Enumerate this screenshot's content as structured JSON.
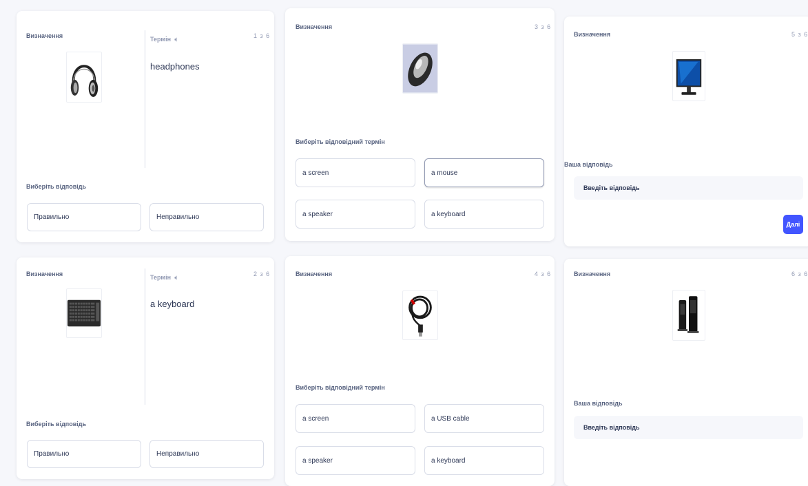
{
  "cards": [
    {
      "definition_label": "Визначення",
      "term_label": "Термін",
      "speaker_icon": "speaker-icon",
      "counter": "1 з 6",
      "image": "headphones-image",
      "term": "headphones",
      "prompt": "Виберіть відповідь",
      "options": [
        "Правильно",
        "Неправильно"
      ]
    },
    {
      "definition_label": "Визначення",
      "term_label": "Термін",
      "speaker_icon": "speaker-icon",
      "counter": "2 з 6",
      "image": "keyboard-image",
      "term": "a keyboard",
      "prompt": "Виберіть відповідь",
      "options": [
        "Правильно",
        "Неправильно"
      ]
    },
    {
      "definition_label": "Визначення",
      "counter": "3 з 6",
      "image": "mouse-image",
      "prompt": "Виберіть відповідний термін",
      "options": [
        "a screen",
        "a mouse",
        "a speaker",
        "a keyboard"
      ],
      "selected": "a mouse"
    },
    {
      "definition_label": "Визначення",
      "counter": "4 з 6",
      "image": "usb-cable-image",
      "prompt": "Виберіть відповідний термін",
      "options": [
        "a screen",
        "a USB cable",
        "a speaker",
        "a keyboard"
      ]
    },
    {
      "definition_label": "Визначення",
      "counter": "5 з 6",
      "image": "monitor-image",
      "answer_label": "Ваша відповідь",
      "input_placeholder": "Введіть відповідь",
      "next_button": "Далі"
    },
    {
      "definition_label": "Визначення",
      "counter": "6 з 6",
      "image": "speakers-image",
      "answer_label": "Ваша відповідь",
      "input_placeholder": "Введіть відповідь"
    }
  ],
  "colors": {
    "accent": "#4255ff",
    "background": "#f6f7fb",
    "card": "#ffffff",
    "text": "#2e3856",
    "muted": "#939bb4"
  }
}
